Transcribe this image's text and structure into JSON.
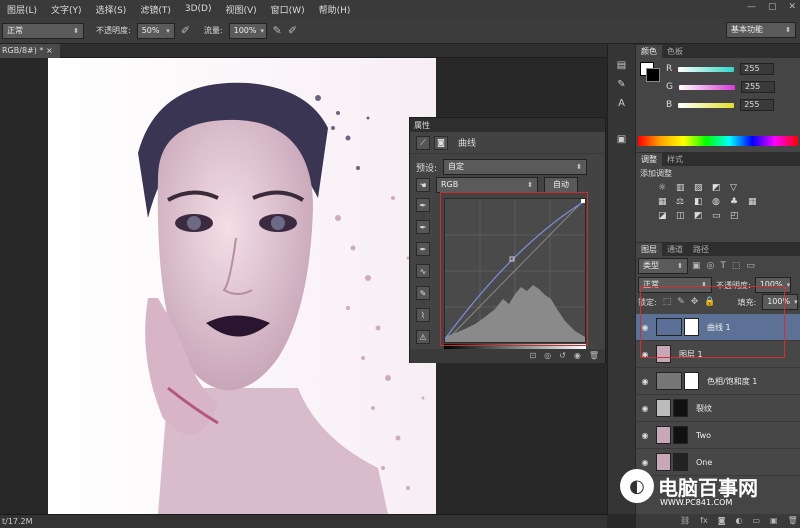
{
  "menu": [
    "图层(L)",
    "文字(Y)",
    "选择(S)",
    "滤镜(T)",
    "3D(D)",
    "视图(V)",
    "窗口(W)",
    "帮助(H)"
  ],
  "window_controls": [
    "—",
    "▢",
    "✕"
  ],
  "options": {
    "mode_value": "正常",
    "opacity_label": "不透明度:",
    "opacity_value": "50%",
    "flow_label": "流量:",
    "flow_value": "100%",
    "workspace": "基本功能"
  },
  "doc_tab": "RGB/8#) *",
  "status": "t/17.2M",
  "properties": {
    "header": "属性",
    "title": "曲线",
    "preset_label": "预设:",
    "preset_value": "自定",
    "channel_value": "RGB",
    "auto_button": "自动"
  },
  "color_panel": {
    "tabs": [
      "颜色",
      "色板"
    ],
    "channels": [
      {
        "label": "R",
        "value": "255",
        "color": "#2fd6c8"
      },
      {
        "label": "G",
        "value": "255",
        "color": "#d63ad6"
      },
      {
        "label": "B",
        "value": "255",
        "color": "#e0e030"
      }
    ]
  },
  "adjust_panel": {
    "tabs": [
      "调整",
      "样式"
    ],
    "title": "添加调整"
  },
  "layers_panel": {
    "tabs": [
      "图层",
      "通道",
      "路径"
    ],
    "filter_value": "类型",
    "blend_value": "正常",
    "opacity_label": "不透明度:",
    "opacity_value": "100%",
    "lock_label": "锁定:",
    "fill_label": "填充:",
    "fill_value": "100%",
    "layers": [
      {
        "name": "曲线 1",
        "selected": true
      },
      {
        "name": "图层 1",
        "selected": false
      },
      {
        "name": "色相/饱和度 1",
        "selected": false
      },
      {
        "name": "裂纹",
        "selected": false
      },
      {
        "name": "Two",
        "selected": false
      },
      {
        "name": "One",
        "selected": false
      }
    ]
  },
  "watermark": {
    "text": "电脑百事网",
    "url": "WWW.PC841.COM"
  }
}
